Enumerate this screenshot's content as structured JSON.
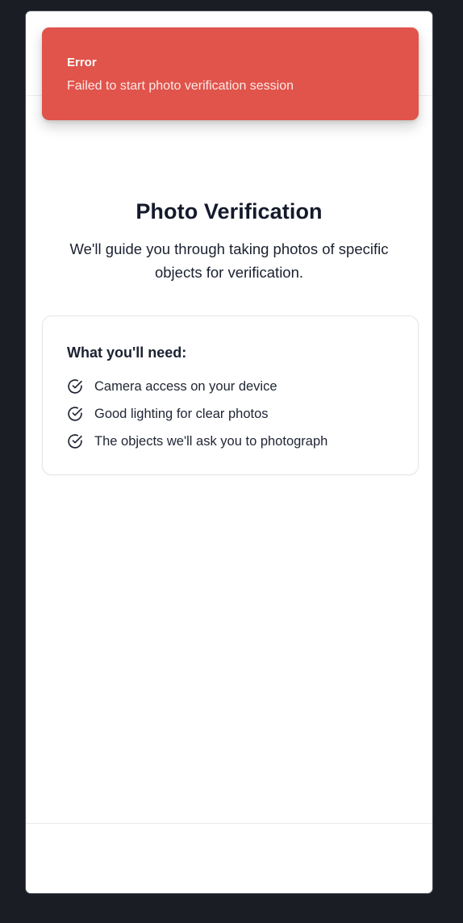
{
  "toast": {
    "title": "Error",
    "message": "Failed to start photo verification session"
  },
  "page": {
    "title": "Photo Verification",
    "subtitle": "We'll guide you through taking photos of specific objects for verification."
  },
  "requirements": {
    "heading": "What you'll need:",
    "items": [
      {
        "label": "Camera access on your device",
        "icon": "check-circle-icon"
      },
      {
        "label": "Good lighting for clear photos",
        "icon": "check-circle-icon"
      },
      {
        "label": "The objects we'll ask you to photograph",
        "icon": "check-circle-icon"
      }
    ]
  },
  "colors": {
    "error": "#e0544b",
    "text": "#141a2b",
    "background": "#1a1d24"
  }
}
